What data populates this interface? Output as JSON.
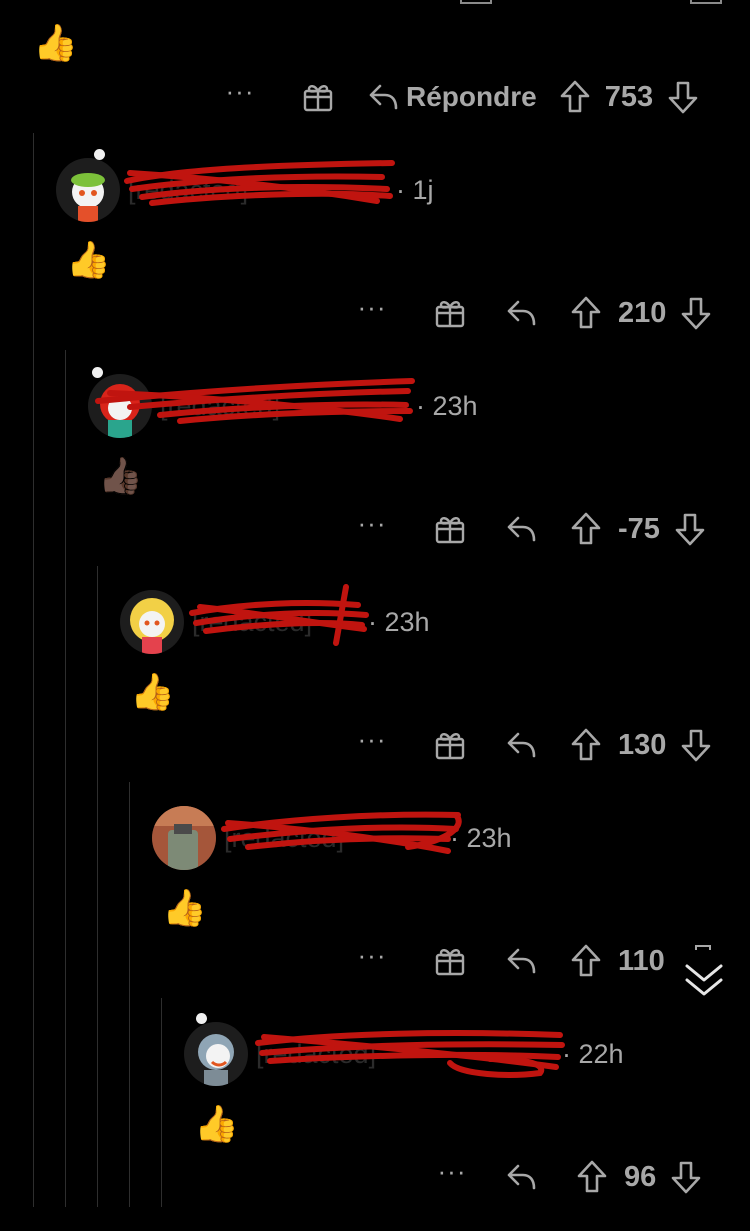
{
  "comments": [
    {
      "emoji": "👍",
      "actions": {
        "reply_label": "Répondre",
        "score": "753"
      }
    },
    {
      "username": "[redacted]",
      "time": "· 1j",
      "emoji": "👍",
      "actions": {
        "score": "210"
      }
    },
    {
      "username": "[redacted]",
      "time": "· 23h",
      "emoji": "👍🏿",
      "actions": {
        "score": "-75"
      }
    },
    {
      "username": "[redacted]",
      "time": "· 23h",
      "emoji": "👍",
      "actions": {
        "score": "130"
      }
    },
    {
      "username": "[redacted]",
      "time": "· 23h",
      "emoji": "👍",
      "actions": {
        "score": "110"
      }
    },
    {
      "username": "[redacted]",
      "time": "· 22h",
      "emoji": "👍",
      "actions": {
        "score": "96"
      }
    }
  ],
  "icons": {
    "more": "more-options-icon",
    "award": "award-gift-icon",
    "reply": "reply-arrow-icon",
    "upvote": "upvote-arrow-icon",
    "downvote": "downvote-arrow-icon",
    "collapse": "collapse-thread-icon"
  },
  "colors": {
    "background": "#000000",
    "text_muted": "#a8a8a8",
    "redaction": "#c0140f",
    "thread_line": "#2e2e2e"
  }
}
